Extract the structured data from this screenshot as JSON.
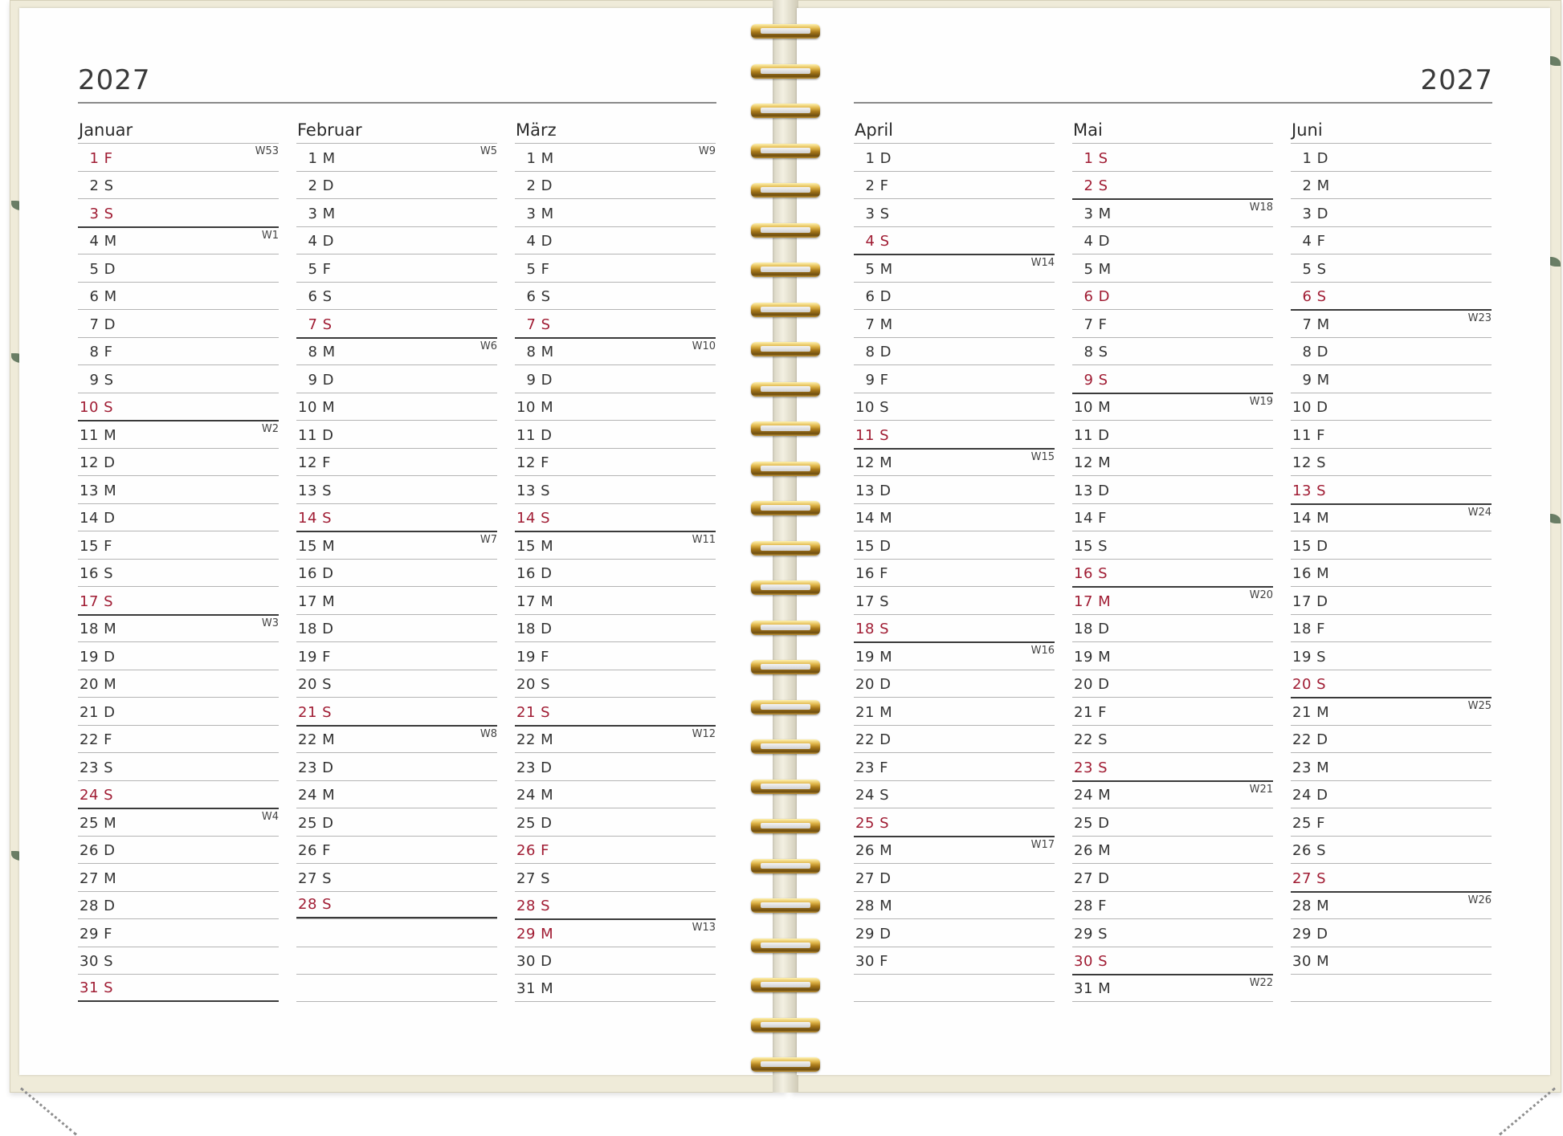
{
  "year": "2027",
  "months": [
    {
      "name": "Januar",
      "days": [
        {
          "d": "1",
          "w": "F",
          "r": true,
          "wk": "W53"
        },
        {
          "d": "2",
          "w": "S"
        },
        {
          "d": "3",
          "w": "S",
          "r": true
        },
        {
          "d": "4",
          "w": "M",
          "wk": "W1",
          "b": true
        },
        {
          "d": "5",
          "w": "D"
        },
        {
          "d": "6",
          "w": "M"
        },
        {
          "d": "7",
          "w": "D"
        },
        {
          "d": "8",
          "w": "F"
        },
        {
          "d": "9",
          "w": "S"
        },
        {
          "d": "10",
          "w": "S",
          "r": true
        },
        {
          "d": "11",
          "w": "M",
          "wk": "W2",
          "b": true
        },
        {
          "d": "12",
          "w": "D"
        },
        {
          "d": "13",
          "w": "M"
        },
        {
          "d": "14",
          "w": "D"
        },
        {
          "d": "15",
          "w": "F"
        },
        {
          "d": "16",
          "w": "S"
        },
        {
          "d": "17",
          "w": "S",
          "r": true
        },
        {
          "d": "18",
          "w": "M",
          "wk": "W3",
          "b": true
        },
        {
          "d": "19",
          "w": "D"
        },
        {
          "d": "20",
          "w": "M"
        },
        {
          "d": "21",
          "w": "D"
        },
        {
          "d": "22",
          "w": "F"
        },
        {
          "d": "23",
          "w": "S"
        },
        {
          "d": "24",
          "w": "S",
          "r": true
        },
        {
          "d": "25",
          "w": "M",
          "wk": "W4",
          "b": true
        },
        {
          "d": "26",
          "w": "D"
        },
        {
          "d": "27",
          "w": "M"
        },
        {
          "d": "28",
          "w": "D"
        },
        {
          "d": "29",
          "w": "F"
        },
        {
          "d": "30",
          "w": "S"
        },
        {
          "d": "31",
          "w": "S",
          "r": true
        }
      ],
      "endbar": true
    },
    {
      "name": "Februar",
      "days": [
        {
          "d": "1",
          "w": "M",
          "wk": "W5"
        },
        {
          "d": "2",
          "w": "D"
        },
        {
          "d": "3",
          "w": "M"
        },
        {
          "d": "4",
          "w": "D"
        },
        {
          "d": "5",
          "w": "F"
        },
        {
          "d": "6",
          "w": "S"
        },
        {
          "d": "7",
          "w": "S",
          "r": true
        },
        {
          "d": "8",
          "w": "M",
          "wk": "W6",
          "b": true
        },
        {
          "d": "9",
          "w": "D"
        },
        {
          "d": "10",
          "w": "M"
        },
        {
          "d": "11",
          "w": "D"
        },
        {
          "d": "12",
          "w": "F"
        },
        {
          "d": "13",
          "w": "S"
        },
        {
          "d": "14",
          "w": "S",
          "r": true
        },
        {
          "d": "15",
          "w": "M",
          "wk": "W7",
          "b": true
        },
        {
          "d": "16",
          "w": "D"
        },
        {
          "d": "17",
          "w": "M"
        },
        {
          "d": "18",
          "w": "D"
        },
        {
          "d": "19",
          "w": "F"
        },
        {
          "d": "20",
          "w": "S"
        },
        {
          "d": "21",
          "w": "S",
          "r": true
        },
        {
          "d": "22",
          "w": "M",
          "wk": "W8",
          "b": true
        },
        {
          "d": "23",
          "w": "D"
        },
        {
          "d": "24",
          "w": "M"
        },
        {
          "d": "25",
          "w": "D"
        },
        {
          "d": "26",
          "w": "F"
        },
        {
          "d": "27",
          "w": "S"
        },
        {
          "d": "28",
          "w": "S",
          "r": true,
          "endb": true
        },
        {
          "d": "",
          "w": ""
        },
        {
          "d": "",
          "w": ""
        },
        {
          "d": "",
          "w": ""
        }
      ]
    },
    {
      "name": "März",
      "days": [
        {
          "d": "1",
          "w": "M",
          "wk": "W9"
        },
        {
          "d": "2",
          "w": "D"
        },
        {
          "d": "3",
          "w": "M"
        },
        {
          "d": "4",
          "w": "D"
        },
        {
          "d": "5",
          "w": "F"
        },
        {
          "d": "6",
          "w": "S"
        },
        {
          "d": "7",
          "w": "S",
          "r": true
        },
        {
          "d": "8",
          "w": "M",
          "wk": "W10",
          "b": true
        },
        {
          "d": "9",
          "w": "D"
        },
        {
          "d": "10",
          "w": "M"
        },
        {
          "d": "11",
          "w": "D"
        },
        {
          "d": "12",
          "w": "F"
        },
        {
          "d": "13",
          "w": "S"
        },
        {
          "d": "14",
          "w": "S",
          "r": true
        },
        {
          "d": "15",
          "w": "M",
          "wk": "W11",
          "b": true
        },
        {
          "d": "16",
          "w": "D"
        },
        {
          "d": "17",
          "w": "M"
        },
        {
          "d": "18",
          "w": "D"
        },
        {
          "d": "19",
          "w": "F"
        },
        {
          "d": "20",
          "w": "S"
        },
        {
          "d": "21",
          "w": "S",
          "r": true
        },
        {
          "d": "22",
          "w": "M",
          "wk": "W12",
          "b": true
        },
        {
          "d": "23",
          "w": "D"
        },
        {
          "d": "24",
          "w": "M"
        },
        {
          "d": "25",
          "w": "D"
        },
        {
          "d": "26",
          "w": "F",
          "r": true
        },
        {
          "d": "27",
          "w": "S"
        },
        {
          "d": "28",
          "w": "S",
          "r": true
        },
        {
          "d": "29",
          "w": "M",
          "r": true,
          "wk": "W13",
          "b": true
        },
        {
          "d": "30",
          "w": "D"
        },
        {
          "d": "31",
          "w": "M"
        }
      ]
    },
    {
      "name": "April",
      "days": [
        {
          "d": "1",
          "w": "D"
        },
        {
          "d": "2",
          "w": "F"
        },
        {
          "d": "3",
          "w": "S"
        },
        {
          "d": "4",
          "w": "S",
          "r": true
        },
        {
          "d": "5",
          "w": "M",
          "wk": "W14",
          "b": true
        },
        {
          "d": "6",
          "w": "D"
        },
        {
          "d": "7",
          "w": "M"
        },
        {
          "d": "8",
          "w": "D"
        },
        {
          "d": "9",
          "w": "F"
        },
        {
          "d": "10",
          "w": "S"
        },
        {
          "d": "11",
          "w": "S",
          "r": true
        },
        {
          "d": "12",
          "w": "M",
          "wk": "W15",
          "b": true
        },
        {
          "d": "13",
          "w": "D"
        },
        {
          "d": "14",
          "w": "M"
        },
        {
          "d": "15",
          "w": "D"
        },
        {
          "d": "16",
          "w": "F"
        },
        {
          "d": "17",
          "w": "S"
        },
        {
          "d": "18",
          "w": "S",
          "r": true
        },
        {
          "d": "19",
          "w": "M",
          "wk": "W16",
          "b": true
        },
        {
          "d": "20",
          "w": "D"
        },
        {
          "d": "21",
          "w": "M"
        },
        {
          "d": "22",
          "w": "D"
        },
        {
          "d": "23",
          "w": "F"
        },
        {
          "d": "24",
          "w": "S"
        },
        {
          "d": "25",
          "w": "S",
          "r": true
        },
        {
          "d": "26",
          "w": "M",
          "wk": "W17",
          "b": true
        },
        {
          "d": "27",
          "w": "D"
        },
        {
          "d": "28",
          "w": "M"
        },
        {
          "d": "29",
          "w": "D"
        },
        {
          "d": "30",
          "w": "F"
        },
        {
          "d": "",
          "w": ""
        }
      ]
    },
    {
      "name": "Mai",
      "days": [
        {
          "d": "1",
          "w": "S",
          "r": true
        },
        {
          "d": "2",
          "w": "S",
          "r": true
        },
        {
          "d": "3",
          "w": "M",
          "wk": "W18",
          "b": true
        },
        {
          "d": "4",
          "w": "D"
        },
        {
          "d": "5",
          "w": "M"
        },
        {
          "d": "6",
          "w": "D",
          "r": true
        },
        {
          "d": "7",
          "w": "F"
        },
        {
          "d": "8",
          "w": "S"
        },
        {
          "d": "9",
          "w": "S",
          "r": true
        },
        {
          "d": "10",
          "w": "M",
          "wk": "W19",
          "b": true
        },
        {
          "d": "11",
          "w": "D"
        },
        {
          "d": "12",
          "w": "M"
        },
        {
          "d": "13",
          "w": "D"
        },
        {
          "d": "14",
          "w": "F"
        },
        {
          "d": "15",
          "w": "S"
        },
        {
          "d": "16",
          "w": "S",
          "r": true
        },
        {
          "d": "17",
          "w": "M",
          "r": true,
          "wk": "W20",
          "b": true
        },
        {
          "d": "18",
          "w": "D"
        },
        {
          "d": "19",
          "w": "M"
        },
        {
          "d": "20",
          "w": "D"
        },
        {
          "d": "21",
          "w": "F"
        },
        {
          "d": "22",
          "w": "S"
        },
        {
          "d": "23",
          "w": "S",
          "r": true
        },
        {
          "d": "24",
          "w": "M",
          "wk": "W21",
          "b": true
        },
        {
          "d": "25",
          "w": "D"
        },
        {
          "d": "26",
          "w": "M"
        },
        {
          "d": "27",
          "w": "D"
        },
        {
          "d": "28",
          "w": "F"
        },
        {
          "d": "29",
          "w": "S"
        },
        {
          "d": "30",
          "w": "S",
          "r": true
        },
        {
          "d": "31",
          "w": "M",
          "wk": "W22",
          "b": true
        }
      ]
    },
    {
      "name": "Juni",
      "days": [
        {
          "d": "1",
          "w": "D"
        },
        {
          "d": "2",
          "w": "M"
        },
        {
          "d": "3",
          "w": "D"
        },
        {
          "d": "4",
          "w": "F"
        },
        {
          "d": "5",
          "w": "S"
        },
        {
          "d": "6",
          "w": "S",
          "r": true
        },
        {
          "d": "7",
          "w": "M",
          "wk": "W23",
          "b": true
        },
        {
          "d": "8",
          "w": "D"
        },
        {
          "d": "9",
          "w": "M"
        },
        {
          "d": "10",
          "w": "D"
        },
        {
          "d": "11",
          "w": "F"
        },
        {
          "d": "12",
          "w": "S"
        },
        {
          "d": "13",
          "w": "S",
          "r": true
        },
        {
          "d": "14",
          "w": "M",
          "wk": "W24",
          "b": true
        },
        {
          "d": "15",
          "w": "D"
        },
        {
          "d": "16",
          "w": "M"
        },
        {
          "d": "17",
          "w": "D"
        },
        {
          "d": "18",
          "w": "F"
        },
        {
          "d": "19",
          "w": "S"
        },
        {
          "d": "20",
          "w": "S",
          "r": true
        },
        {
          "d": "21",
          "w": "M",
          "wk": "W25",
          "b": true
        },
        {
          "d": "22",
          "w": "D"
        },
        {
          "d": "23",
          "w": "M"
        },
        {
          "d": "24",
          "w": "D"
        },
        {
          "d": "25",
          "w": "F"
        },
        {
          "d": "26",
          "w": "S"
        },
        {
          "d": "27",
          "w": "S",
          "r": true
        },
        {
          "d": "28",
          "w": "M",
          "wk": "W26",
          "b": true
        },
        {
          "d": "29",
          "w": "D"
        },
        {
          "d": "30",
          "w": "M"
        },
        {
          "d": "",
          "w": ""
        }
      ]
    }
  ],
  "colors": {
    "holiday": "#a01c33",
    "ring": "#c9a13c",
    "cover": "#efebd9"
  }
}
